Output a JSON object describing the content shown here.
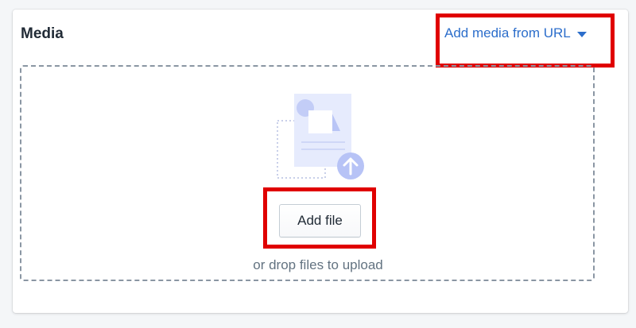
{
  "card": {
    "title": "Media",
    "add_from_url_label": "Add media from URL"
  },
  "dropzone": {
    "add_file_label": "Add file",
    "hint": "or drop files to upload"
  },
  "icons": {
    "upload_illustration": "file-upload-icon",
    "caret": "caret-down-icon"
  },
  "colors": {
    "link": "#2c6ecb",
    "highlight": "#e00000",
    "title": "#212b36",
    "hint": "#637381",
    "illustration": "#e3e8fc",
    "upload_circle": "#b7c3f6"
  }
}
